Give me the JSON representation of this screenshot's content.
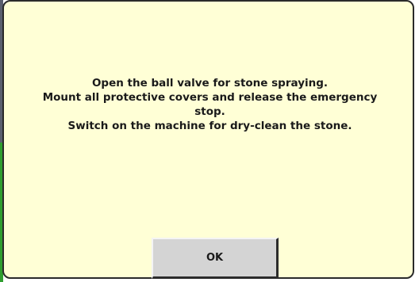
{
  "dialog": {
    "message_lines": [
      "Open the ball valve for stone spraying.",
      "Mount all protective covers and release the emergency",
      "stop.",
      "Switch on the machine for dry-clean the stone."
    ],
    "ok_label": "OK"
  },
  "colors": {
    "dialog_background": "#ffffd6",
    "button_face": "#d4d4d4"
  }
}
